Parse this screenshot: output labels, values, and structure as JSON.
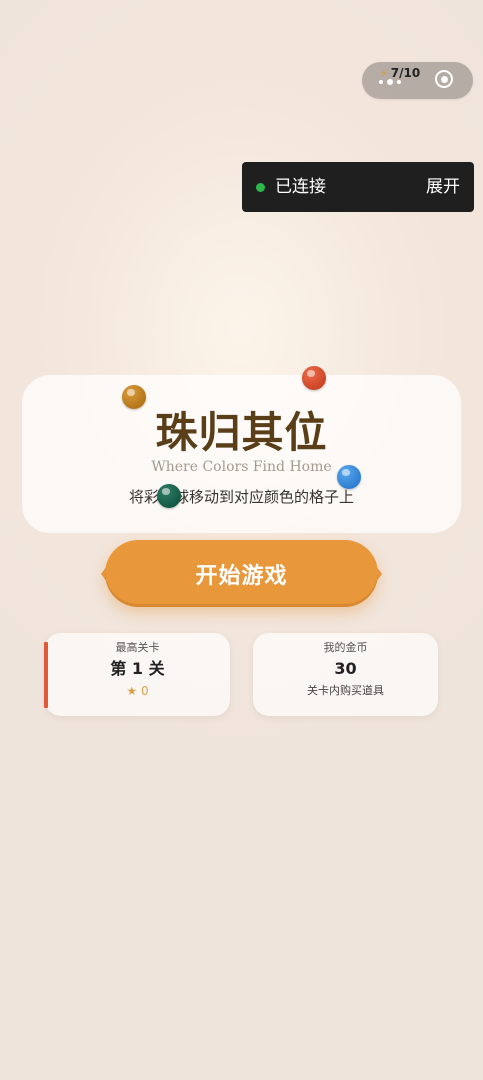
{
  "capsule": {
    "badge": "7/10",
    "badge_icon": "lightning-icon",
    "more_icon": "more-dots-icon",
    "close_icon": "target-close-icon"
  },
  "connection": {
    "status": "已连接",
    "expand_label": "展开",
    "status_color": "#2db84d"
  },
  "title_card": {
    "title": "珠归其位",
    "subtitle": "Where Colors Find Home",
    "description": "将彩色球移动到对应颜色的格子上"
  },
  "balls": [
    "#c7862a",
    "#dd5533",
    "#3a8fe0",
    "#1a6b54"
  ],
  "start_button": {
    "label": "开始游戏",
    "color": "#e8973a"
  },
  "stats": {
    "highest_level": {
      "label": "最高关卡",
      "value": "第 1 关",
      "stars": "★ 0",
      "accent": "#e05a3a"
    },
    "coins": {
      "label": "我的金币",
      "value": "30",
      "note": "关卡内购买道具"
    }
  }
}
